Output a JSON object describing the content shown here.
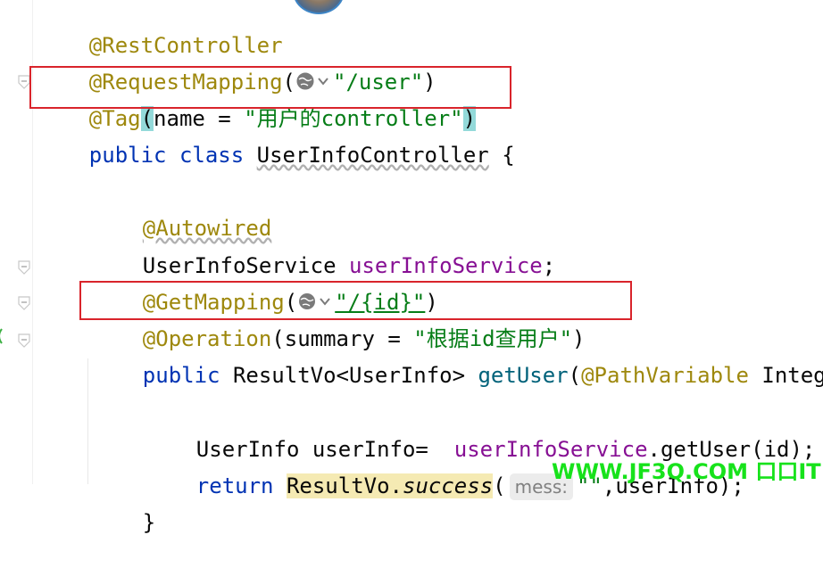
{
  "editor": {
    "lines": {
      "l1": {
        "annotation": "@RestController"
      },
      "l2": {
        "annotation": "@RequestMapping",
        "open": "(",
        "string": "\"/user\"",
        "close": ")"
      },
      "l3": {
        "annotation": "@Tag",
        "open": "(",
        "body": "name = ",
        "string": "\"用户的controller\"",
        "close": ")"
      },
      "l4": {
        "kw1": "public",
        "kw2": "class",
        "classname": "UserInfoController",
        "brace": " {"
      },
      "l6": {
        "annotation": "@Autowired"
      },
      "l7": {
        "type": "UserInfoService ",
        "field": "userInfoService",
        "end": ";"
      },
      "l8": {
        "annotation": "@GetMapping",
        "open": "(",
        "string": "\"/{id}\"",
        "close": ")"
      },
      "l9": {
        "annotation": "@Operation",
        "open": "(",
        "body": "summary = ",
        "string": "\"根据id查用户\"",
        "close": ")"
      },
      "l10": {
        "kw": "public",
        "text": " ResultVo<UserInfo> ",
        "method": "getUser",
        "open": "(",
        "param_ann": "@PathVariable",
        "rest": " Integer"
      },
      "l12": {
        "text": "UserInfo userInfo=  ",
        "field": "userInfoService",
        "call": ".getUser(id);"
      },
      "l13": {
        "kw": "return",
        "space": " ",
        "cls": "ResultVo",
        "dot": ".",
        "method": "success",
        "open": "(",
        "hint": "mess:",
        "string": "\"\"",
        "rest": ",userInfo);"
      },
      "l14": {
        "brace": "}"
      }
    }
  },
  "watermark": {
    "text": "WWW.JF3Q.COM 口口IT"
  },
  "colors": {
    "annotation": "#9e880d",
    "keyword": "#0033b3",
    "string": "#067d17",
    "field": "#871094",
    "method": "#00627a",
    "highlight_box": "#d9242b",
    "watermark": "#17e21b"
  },
  "icons": [
    "globe-icon",
    "chevron-down-icon",
    "fold-marker-icon",
    "avatar"
  ]
}
